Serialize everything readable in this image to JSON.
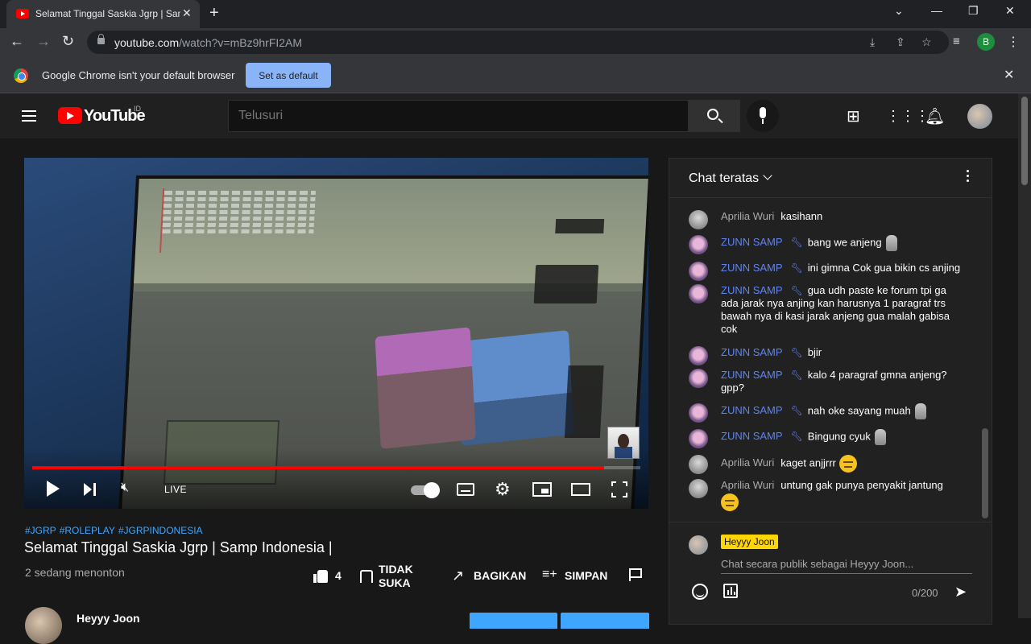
{
  "browser": {
    "tab_title": "Selamat Tinggal Saskia Jgrp | Samp Indonesia |",
    "tab_close": "✕",
    "new_tab": "+",
    "url_host": "youtube.com",
    "url_path": "/watch?v=mBz9hrFI2AM",
    "profile_initial": "B",
    "infobar_text": "Google Chrome isn't your default browser",
    "infobar_button": "Set as default",
    "infobar_close": "✕"
  },
  "masthead": {
    "logo_text": "YouTube",
    "country": "ID",
    "search_placeholder": "Telusuri"
  },
  "video": {
    "live_label": "LIVE",
    "progress_fraction": 0.94,
    "hashtags": [
      "#JGRP",
      "#ROLEPLAY",
      "#JGRPINDONESIA"
    ],
    "title": "Selamat Tinggal Saskia Jgrp | Samp Indonesia |",
    "viewers": "2 sedang menonton",
    "like_count": "4",
    "dislike_label_1": "TIDAK",
    "dislike_label_2": "SUKA",
    "share_label": "BAGIKAN",
    "save_label": "SIMPAN",
    "channel_name": "Heyyy Joon"
  },
  "chat": {
    "title": "Chat teratas",
    "messages": [
      {
        "author": "Aprilia Wuri",
        "text": "kasihann"
      },
      {
        "author": "ZUNN SAMP",
        "text": "bang we anjeng"
      },
      {
        "author": "ZUNN SAMP",
        "text": "ini gimna Cok gua bikin cs anjing"
      },
      {
        "author": "ZUNN SAMP",
        "text": "gua udh paste ke forum tpi ga ada jarak nya anjing kan harusnya 1 paragraf trs bawah nya di kasi jarak anjeng gua malah gabisa cok"
      },
      {
        "author": "ZUNN SAMP",
        "text": "bjir"
      },
      {
        "author": "ZUNN SAMP",
        "text": "kalo 4 paragraf gmna anjeng? gpp?"
      },
      {
        "author": "ZUNN SAMP",
        "text": "nah oke sayang muah"
      },
      {
        "author": "ZUNN SAMP",
        "text": "Bingung cyuk"
      },
      {
        "author": "Aprilia Wuri",
        "text": "kaget anjjrrr"
      },
      {
        "author": "Aprilia Wuri",
        "text": "untung gak punya penyakit jantung"
      }
    ],
    "input_name": "Heyyy Joon",
    "input_placeholder": "Chat secara publik sebagai Heyyy Joon...",
    "char_count": "0/200"
  }
}
